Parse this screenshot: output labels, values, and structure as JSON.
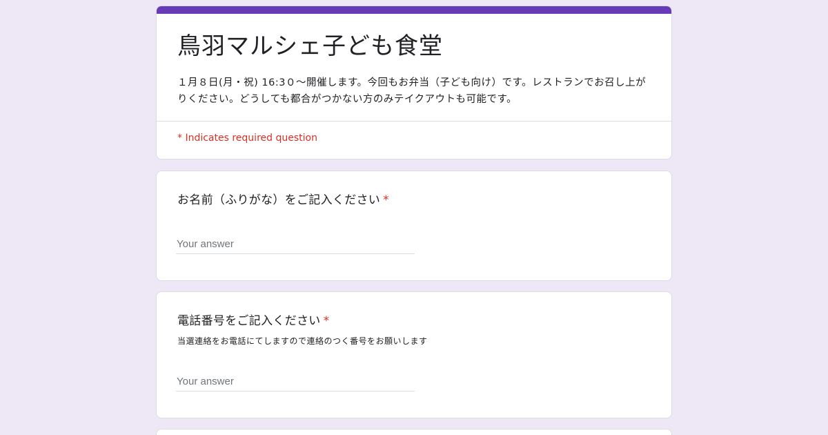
{
  "form": {
    "title": "鳥羽マルシェ子ども食堂",
    "description": "１月８日(月・祝) 16:3０〜開催します。今回もお弁当（子ども向け）です。レストランでお召し上がりください。どうしても都合がつかない方のみテイクアウトも可能です。",
    "required_note": "* Indicates required question",
    "accent_color": "#673ab7",
    "background_color": "#ede7f6",
    "required_color": "#d93025"
  },
  "questions": [
    {
      "title": "お名前（ふりがな）をご記入ください",
      "required_mark": "*",
      "help_text": "",
      "placeholder": "Your answer"
    },
    {
      "title": "電話番号をご記入ください",
      "required_mark": "*",
      "help_text": "当選連絡をお電話にてしますので連絡のつく番号をお願いします",
      "placeholder": "Your answer"
    }
  ]
}
